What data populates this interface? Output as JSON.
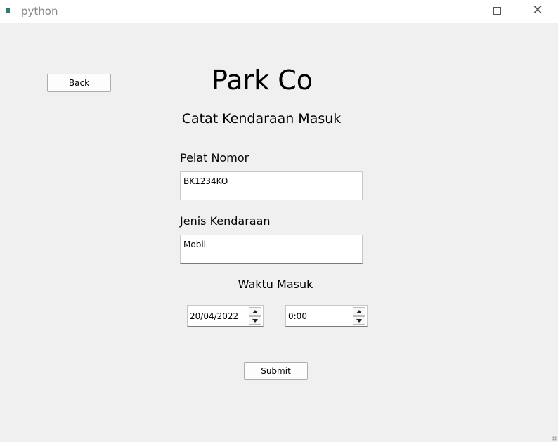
{
  "window": {
    "title": "python"
  },
  "header": {
    "back_label": "Back",
    "app_title": "Park Co",
    "subtitle": "Catat Kendaraan Masuk"
  },
  "form": {
    "plate_label": "Pelat Nomor",
    "plate_value": "BK1234KO",
    "vehicle_type_label": "Jenis Kendaraan",
    "vehicle_type_value": "Mobil",
    "entry_time_label": "Waktu Masuk",
    "date_value": "20/04/2022",
    "time_value": "0:00",
    "submit_label": "Submit"
  },
  "icons": {
    "app": "python-window-icon",
    "minimize": "minimize-icon",
    "maximize": "maximize-icon",
    "close": "close-icon"
  }
}
